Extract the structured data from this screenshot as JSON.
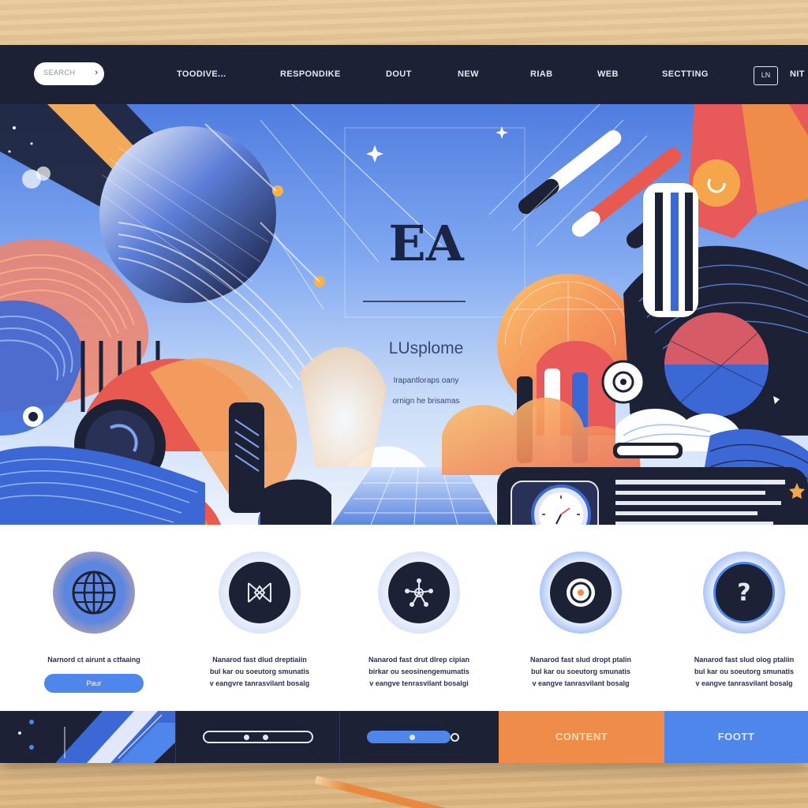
{
  "nav": {
    "search_placeholder": "SEARCH",
    "items": [
      "TOODIVE...",
      "RESPONDIKE",
      "DOUT",
      "NEW",
      "RIAB",
      "WEB",
      "SECTTING",
      "NIT"
    ],
    "icon_box_label": "LN"
  },
  "hero": {
    "title": "EA",
    "subtitle": "LUsplome",
    "line1": "Irapantloraps oany",
    "line2": "ornign he brisamas"
  },
  "features": [
    {
      "icon": "globe-icon",
      "caption_lines": [
        "Narnord ct airunt a ctfaaing"
      ],
      "cta": "Paur"
    },
    {
      "icon": "network-icon",
      "caption_lines": [
        "Nanarod fast dlud dreptiaiin",
        "bul kar ou soeutorg smunatis",
        "v eangvre tanrasvilant bosalg"
      ]
    },
    {
      "icon": "molecule-icon",
      "caption_lines": [
        "Nanarod fast drut dlrep cipian",
        "birkar ou seosinengemumatis",
        "v eangve tenrasvilant bosalgi"
      ]
    },
    {
      "icon": "target-icon",
      "caption_lines": [
        "Nanarod fast slud dropt ptalin",
        "bul kar ou soeutorg smunatis",
        "v eangve tanrasvilant bosalg"
      ]
    },
    {
      "icon": "question-icon",
      "caption_lines": [
        "Nanarod fast slud olog ptaliin",
        "bul kar ou soeutorg smunatis",
        "v eangve tanrasvilant bosalg"
      ]
    }
  ],
  "footer": {
    "content_label": "CONTENT",
    "foot_label": "FOOTT"
  },
  "colors": {
    "navy": "#1c2136",
    "blue": "#4f86ec",
    "orange": "#f08c4a",
    "coral": "#e85a5a"
  }
}
